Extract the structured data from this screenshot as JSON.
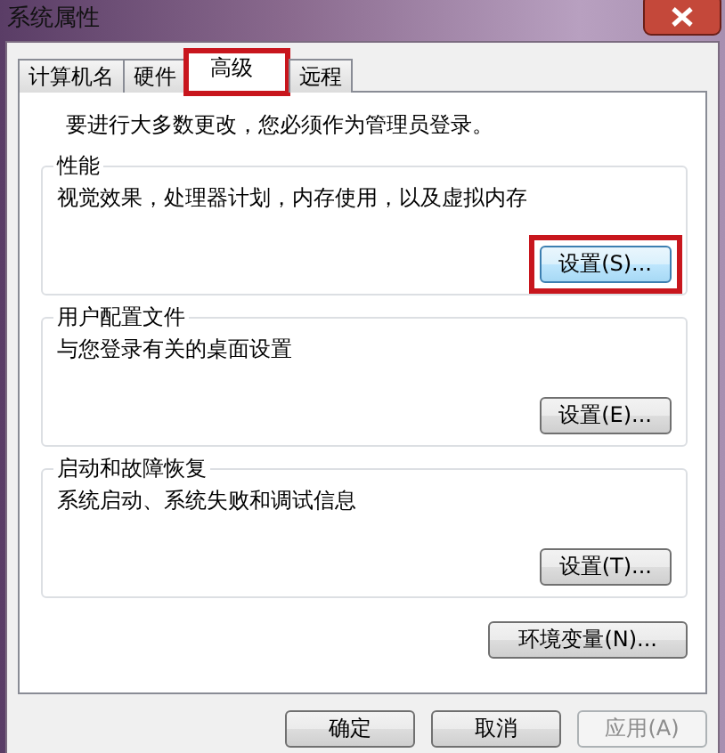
{
  "window": {
    "title": "系统属性"
  },
  "tabs": [
    {
      "label": "计算机名",
      "selected": false,
      "highlighted": false
    },
    {
      "label": "硬件",
      "selected": false,
      "highlighted": false
    },
    {
      "label": "高级",
      "selected": true,
      "highlighted": true
    },
    {
      "label": "远程",
      "selected": false,
      "highlighted": false
    }
  ],
  "notice": "要进行大多数更改，您必须作为管理员登录。",
  "sections": [
    {
      "title": "性能",
      "description": "视觉效果，处理器计划，内存使用，以及虚拟内存",
      "button": "设置(S)...",
      "focused": true,
      "highlighted": true
    },
    {
      "title": "用户配置文件",
      "description": "与您登录有关的桌面设置",
      "button": "设置(E)...",
      "focused": false,
      "highlighted": false
    },
    {
      "title": "启动和故障恢复",
      "description": "系统启动、系统失败和调试信息",
      "button": "设置(T)...",
      "focused": false,
      "highlighted": false
    }
  ],
  "environment_button": "环境变量(N)...",
  "buttons": [
    {
      "label": "确定",
      "disabled": false
    },
    {
      "label": "取消",
      "disabled": false
    },
    {
      "label": "应用(A)",
      "disabled": true
    }
  ]
}
